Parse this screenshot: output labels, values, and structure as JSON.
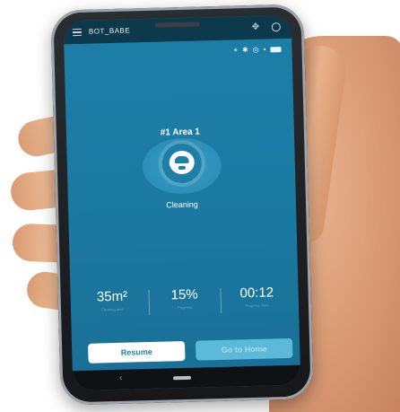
{
  "app": {
    "title": "BOT_BABE"
  },
  "icons": {
    "menu": "menu-icon",
    "move": "move-icon",
    "settings": "settings-icon",
    "back": "back-icon",
    "robot": "robot-vacuum-icon"
  },
  "status_icons": [
    "⌖",
    "✱",
    "◎",
    "•",
    "▢"
  ],
  "main": {
    "area_label": "#1 Area 1",
    "status": "Cleaning"
  },
  "stats": [
    {
      "value": "35m²",
      "caption": "Cleaning area"
    },
    {
      "value": "15%",
      "caption": "Progress"
    },
    {
      "value": "00:12",
      "caption": "Progress Time"
    }
  ],
  "buttons": {
    "resume": "Resume",
    "go_home": "Go to Home"
  },
  "navbar": {
    "back_glyph": "‹"
  },
  "colors": {
    "screen_bg": "#1c7fa8",
    "accent": "#1e7fa6",
    "go_home_bg": "#5cbad8"
  }
}
